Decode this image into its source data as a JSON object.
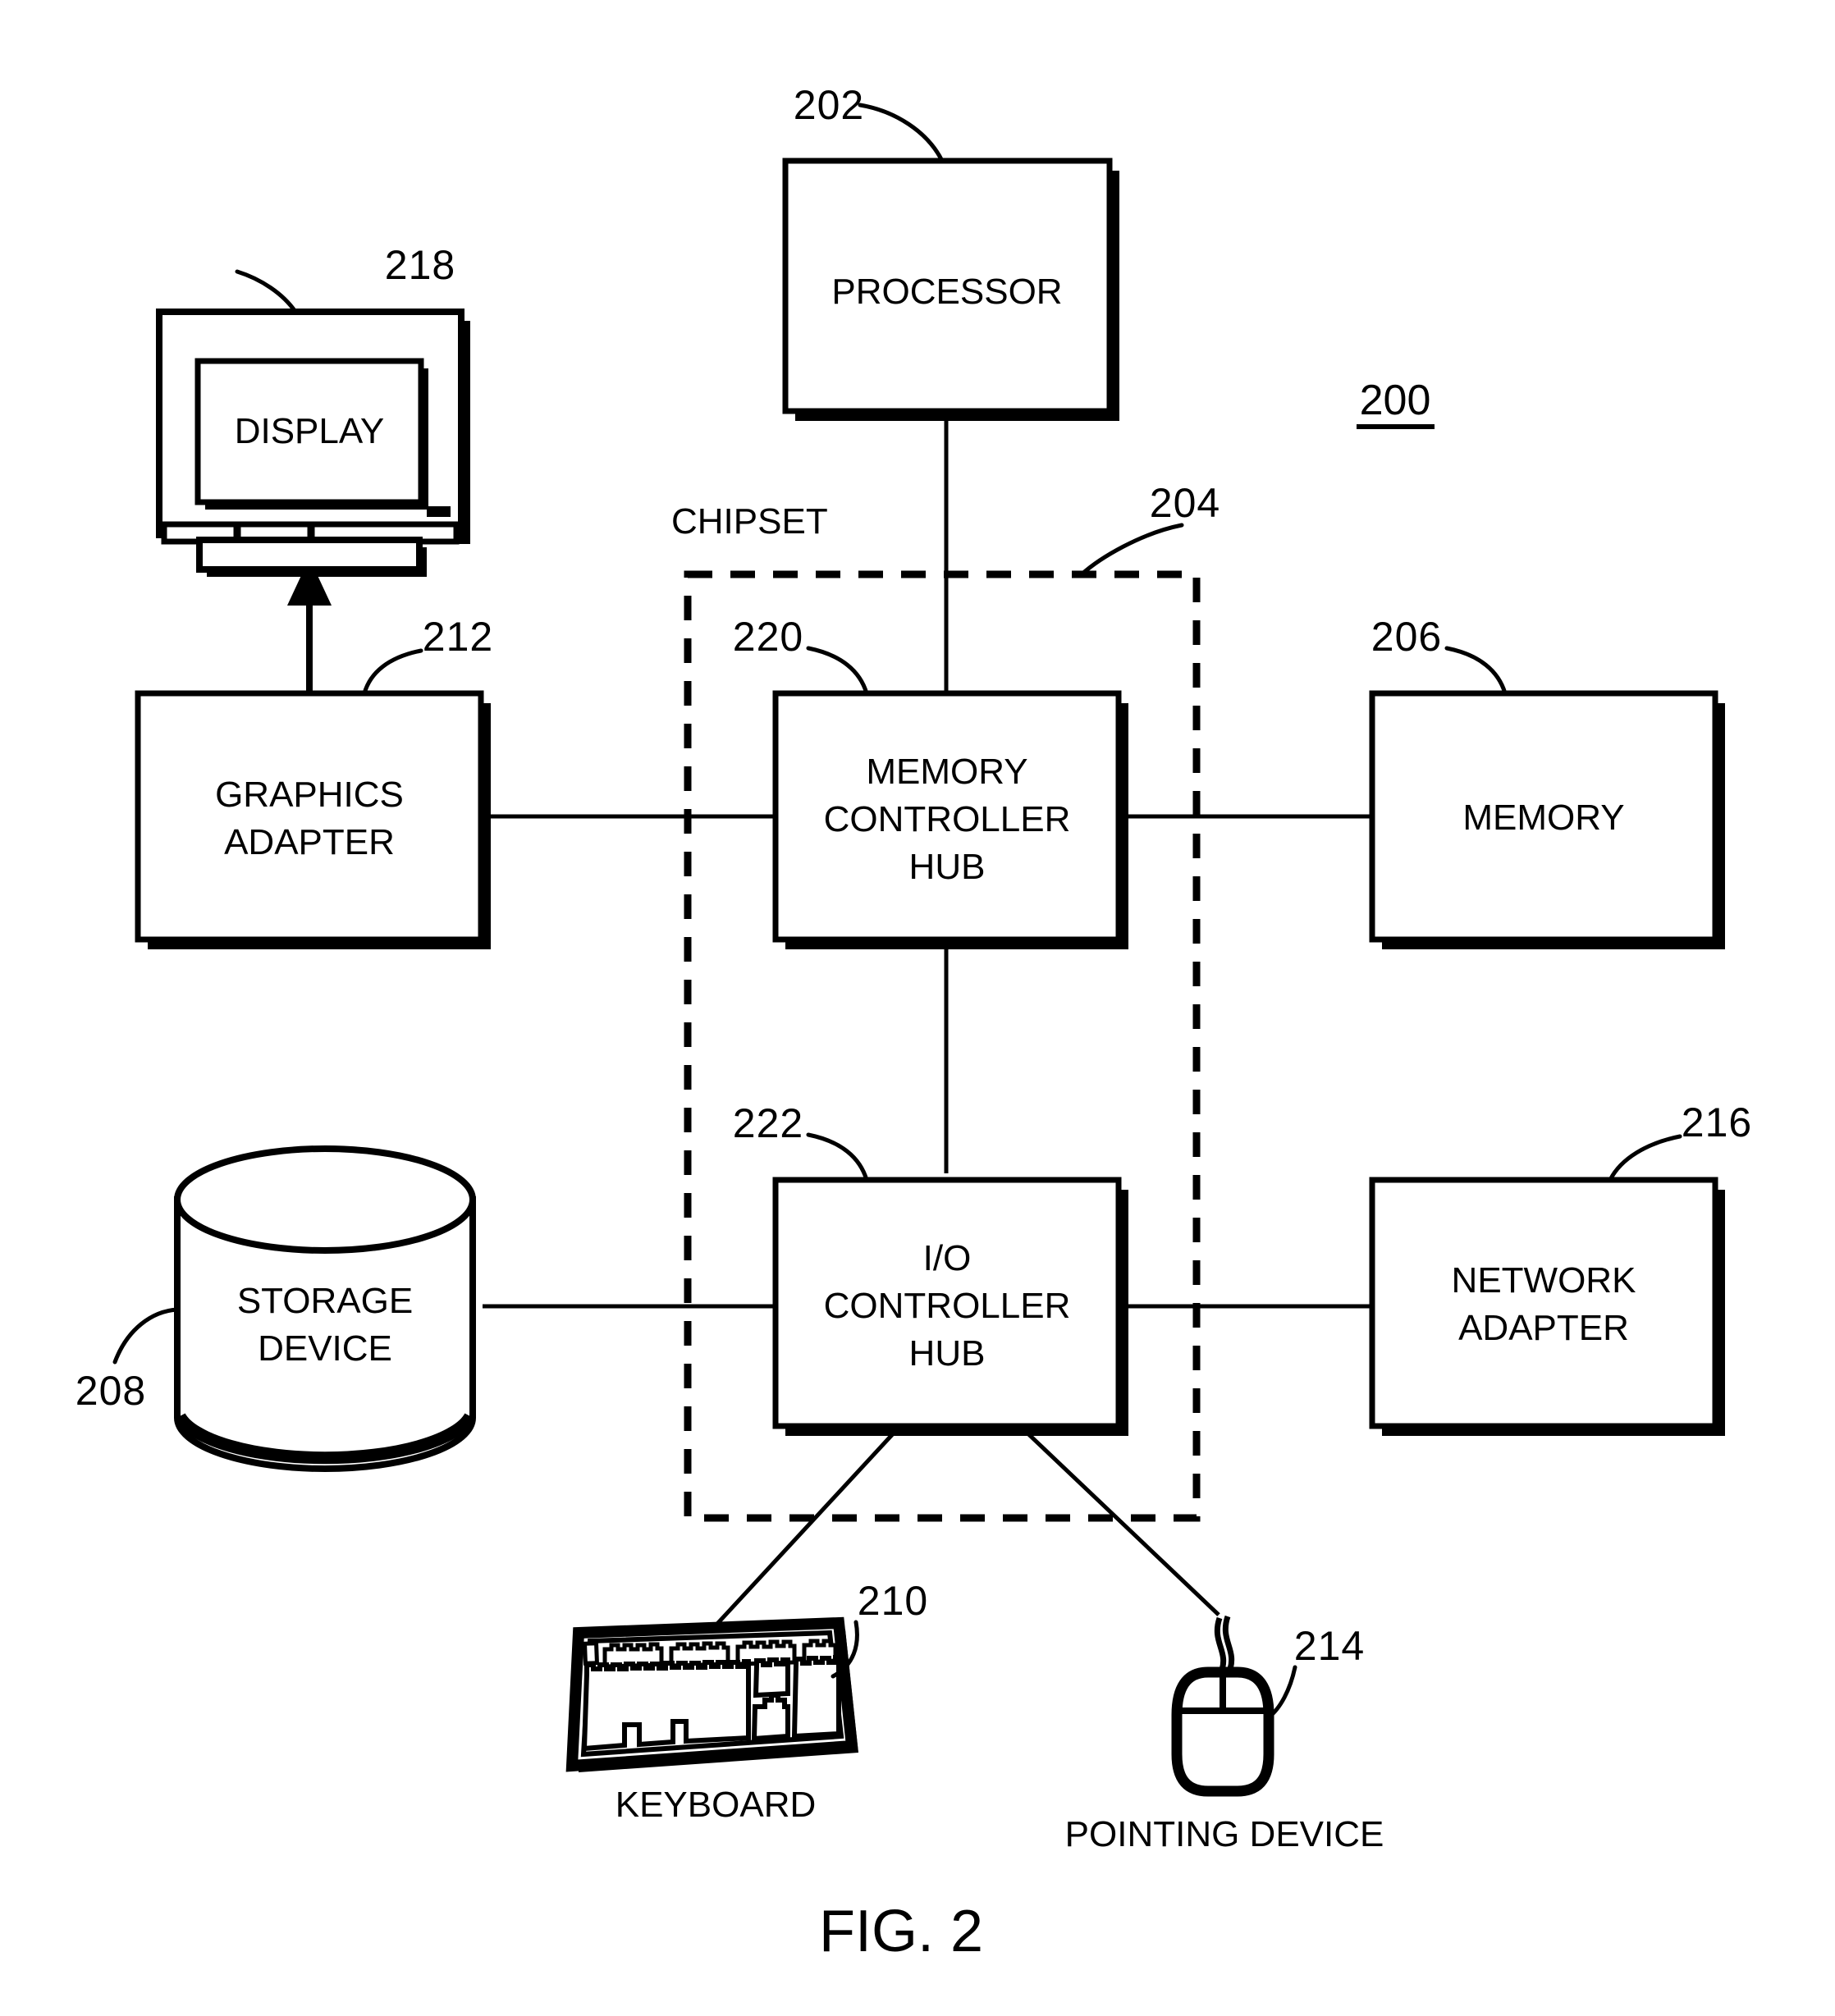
{
  "figure": {
    "caption": "FIG. 2",
    "system_reference": "200",
    "chipset_label": "CHIPSET"
  },
  "blocks": [
    {
      "id": "processor",
      "label_lines": [
        "PROCESSOR"
      ],
      "ref": "202"
    },
    {
      "id": "memory_controller",
      "label_lines": [
        "MEMORY",
        "CONTROLLER",
        "HUB"
      ],
      "ref": "220"
    },
    {
      "id": "io_controller",
      "label_lines": [
        "I/O",
        "CONTROLLER",
        "HUB"
      ],
      "ref": "222"
    },
    {
      "id": "memory",
      "label_lines": [
        "MEMORY"
      ],
      "ref": "206"
    },
    {
      "id": "graphics_adapter",
      "label_lines": [
        "GRAPHICS",
        "ADAPTER"
      ],
      "ref": "212"
    },
    {
      "id": "network_adapter",
      "label_lines": [
        "NETWORK",
        "ADAPTER"
      ],
      "ref": "216"
    },
    {
      "id": "storage_device",
      "label_lines": [
        "STORAGE",
        "DEVICE"
      ],
      "ref": "208"
    },
    {
      "id": "display",
      "label_lines": [
        "DISPLAY"
      ],
      "ref": "218"
    },
    {
      "id": "keyboard",
      "label_lines": [
        "KEYBOARD"
      ],
      "ref": "210"
    },
    {
      "id": "pointing_device",
      "label_lines": [
        "POINTING DEVICE"
      ],
      "ref": "214"
    },
    {
      "id": "chipset",
      "label_lines": [
        "CHIPSET"
      ],
      "ref": "204"
    }
  ],
  "text": {
    "processor": "PROCESSOR",
    "memory_controller_l1": "MEMORY",
    "memory_controller_l2": "CONTROLLER",
    "memory_controller_l3": "HUB",
    "io_controller_l1": "I/O",
    "io_controller_l2": "CONTROLLER",
    "io_controller_l3": "HUB",
    "memory": "MEMORY",
    "graphics_l1": "GRAPHICS",
    "graphics_l2": "ADAPTER",
    "network_l1": "NETWORK",
    "network_l2": "ADAPTER",
    "storage_l1": "STORAGE",
    "storage_l2": "DEVICE",
    "display": "DISPLAY",
    "keyboard": "KEYBOARD",
    "pointing_device": "POINTING DEVICE",
    "chipset": "CHIPSET",
    "caption": "FIG. 2"
  },
  "refs": {
    "system": "200",
    "processor": "202",
    "chipset": "204",
    "memory": "206",
    "storage": "208",
    "keyboard": "210",
    "graphics": "212",
    "pointing": "214",
    "network": "216",
    "display": "218",
    "mch": "220",
    "ich": "222"
  },
  "connections": [
    {
      "from": "processor",
      "to": "memory_controller"
    },
    {
      "from": "graphics_adapter",
      "to": "memory_controller"
    },
    {
      "from": "memory_controller",
      "to": "memory"
    },
    {
      "from": "memory_controller",
      "to": "io_controller"
    },
    {
      "from": "storage_device",
      "to": "io_controller"
    },
    {
      "from": "io_controller",
      "to": "network_adapter"
    },
    {
      "from": "io_controller",
      "to": "keyboard"
    },
    {
      "from": "io_controller",
      "to": "pointing_device"
    },
    {
      "from": "graphics_adapter",
      "to": "display",
      "arrow": true
    }
  ],
  "colors": {
    "line": "#000000",
    "background": "#ffffff",
    "fill": "#ffffff"
  }
}
